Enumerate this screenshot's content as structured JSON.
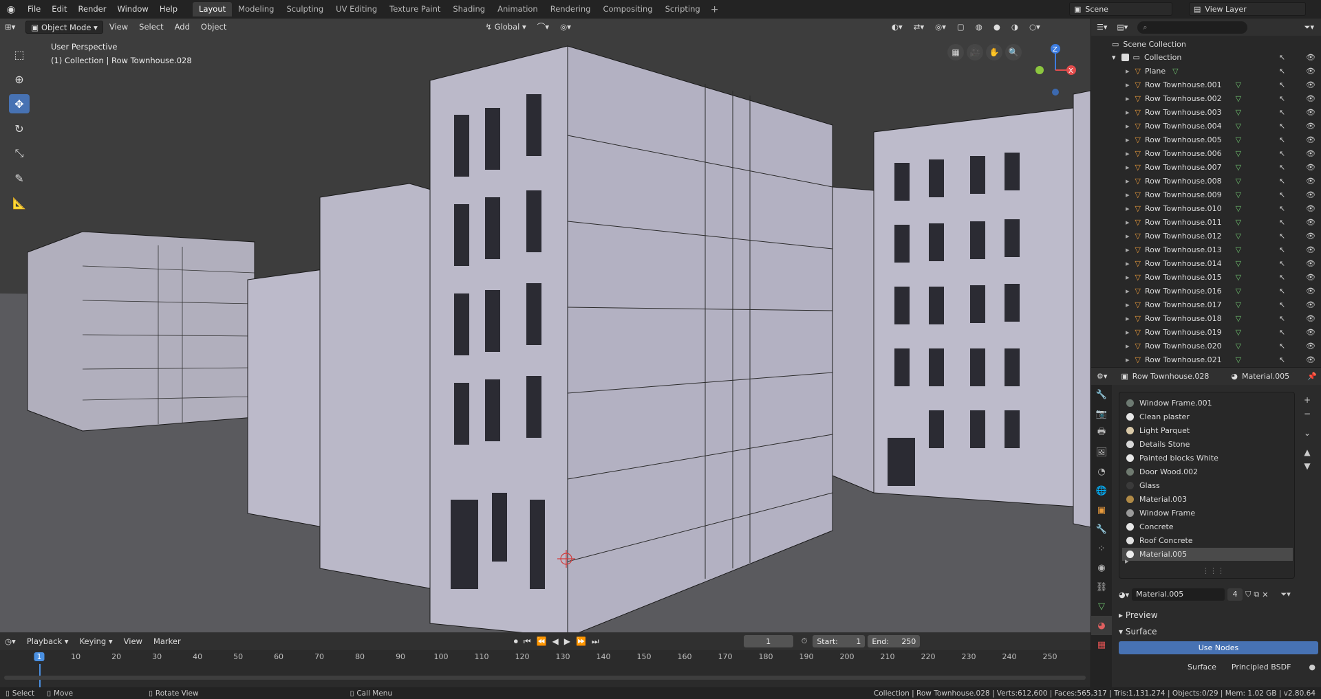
{
  "topbar": {
    "menus": [
      "File",
      "Edit",
      "Render",
      "Window",
      "Help"
    ],
    "workspaces": [
      "Layout",
      "Modeling",
      "Sculpting",
      "UV Editing",
      "Texture Paint",
      "Shading",
      "Animation",
      "Rendering",
      "Compositing",
      "Scripting"
    ],
    "active_workspace": "Layout",
    "scene": "Scene",
    "view_layer": "View Layer"
  },
  "viewport": {
    "mode": "Object Mode",
    "menus": [
      "View",
      "Select",
      "Add",
      "Object"
    ],
    "orientation": "Global",
    "perspective_label": "User Perspective",
    "collection_label": "(1) Collection | Row Townhouse.028",
    "gizmo_axes": {
      "x": "X",
      "y": "Y",
      "z": "Z"
    },
    "colors": {
      "x": "#e34d4d",
      "y": "#8cc63f",
      "z": "#3c7ce0",
      "bg": "#3d3d3d",
      "ground": "#5b5b5f",
      "wall": "#b5b3c2"
    }
  },
  "outliner": {
    "root": "Scene Collection",
    "collection": "Collection",
    "items": [
      "Plane",
      "Row Townhouse.001",
      "Row Townhouse.002",
      "Row Townhouse.003",
      "Row Townhouse.004",
      "Row Townhouse.005",
      "Row Townhouse.006",
      "Row Townhouse.007",
      "Row Townhouse.008",
      "Row Townhouse.009",
      "Row Townhouse.010",
      "Row Townhouse.011",
      "Row Townhouse.012",
      "Row Townhouse.013",
      "Row Townhouse.014",
      "Row Townhouse.015",
      "Row Townhouse.016",
      "Row Townhouse.017",
      "Row Townhouse.018",
      "Row Townhouse.019",
      "Row Townhouse.020",
      "Row Townhouse.021"
    ]
  },
  "properties": {
    "object": "Row Townhouse.028",
    "material": "Material.005",
    "slots": [
      "Window Frame.001",
      "Clean plaster",
      "Light Parquet",
      "Details Stone",
      "Painted blocks White",
      "Door Wood.002",
      "Glass",
      "Material.003",
      "Window Frame",
      "Concrete",
      "Roof Concrete",
      "Material.005"
    ],
    "slot_colors": [
      "#6d7a72",
      "#e6e6e6",
      "#d9c9a8",
      "#d8d8d8",
      "#e8e8e8",
      "#6f7a70",
      "#3a3a3a",
      "#b08a46",
      "#9a9a9a",
      "#e6e6e6",
      "#e2e2e2",
      "#ededed"
    ],
    "selected_slot": "Material.005",
    "user_count": "4",
    "sections": [
      "Preview",
      "Surface"
    ],
    "use_nodes": "Use Nodes",
    "surface_label": "Surface",
    "surface_value": "Principled BSDF"
  },
  "timeline": {
    "menus": [
      "Playback",
      "Keying",
      "View",
      "Marker"
    ],
    "current_frame": "1",
    "start_label": "Start:",
    "start": "1",
    "end_label": "End:",
    "end": "250",
    "ticks": [
      "1",
      "10",
      "20",
      "30",
      "40",
      "50",
      "60",
      "70",
      "80",
      "90",
      "100",
      "110",
      "120",
      "130",
      "140",
      "150",
      "160",
      "170",
      "180",
      "190",
      "200",
      "210",
      "220",
      "230",
      "240",
      "250"
    ]
  },
  "status": {
    "select": "Select",
    "move": "Move",
    "rotate": "Rotate View",
    "call_menu": "Call Menu",
    "stats": "Collection | Row Townhouse.028 | Verts:612,600 | Faces:565,317 | Tris:1,131,274 | Objects:0/29 | Mem: 1.02 GB | v2.80.64"
  }
}
